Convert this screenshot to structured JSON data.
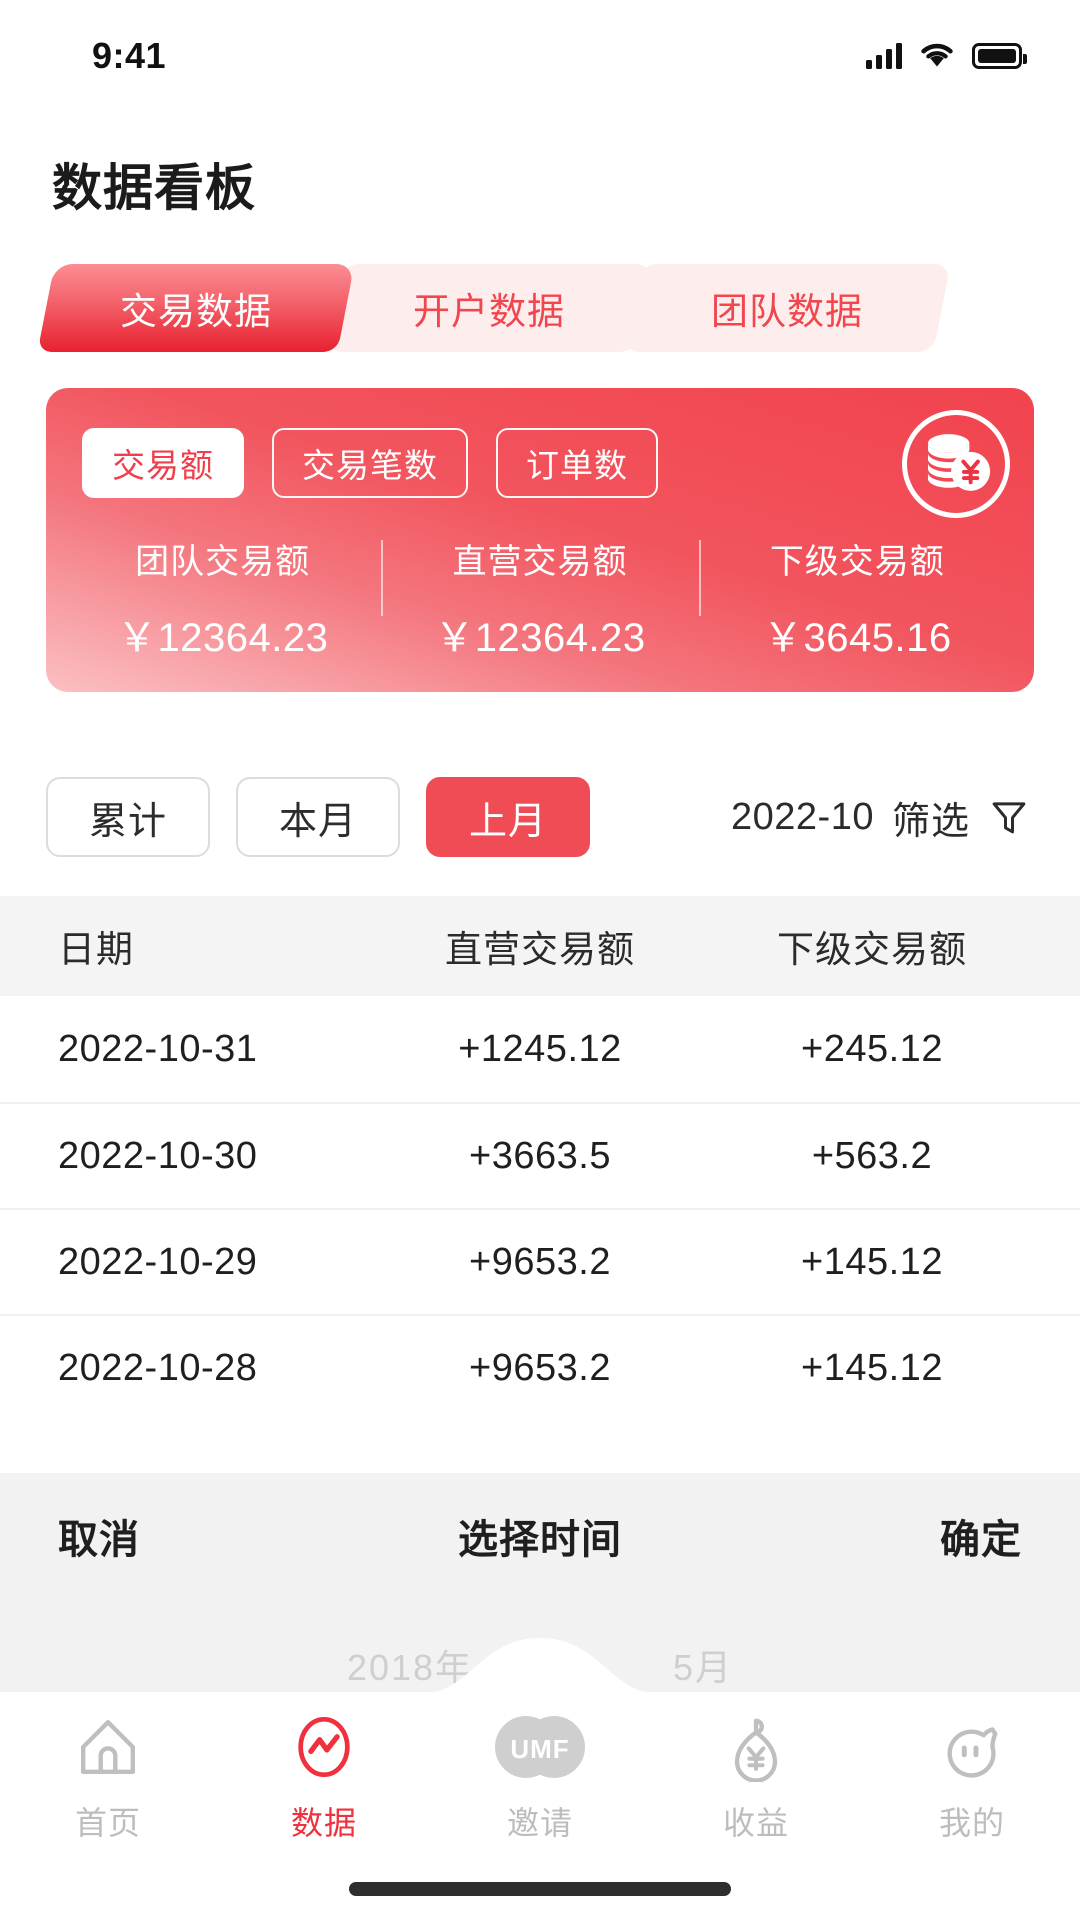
{
  "status_bar": {
    "time": "9:41",
    "signal_icon": "cellular-signal-icon",
    "wifi_icon": "wifi-icon",
    "battery_icon": "battery-icon"
  },
  "page": {
    "title": "数据看板"
  },
  "tabs": [
    {
      "label": "交易数据",
      "active": true
    },
    {
      "label": "开户数据",
      "active": false
    },
    {
      "label": "团队数据",
      "active": false
    }
  ],
  "summary_card": {
    "badge_icon": "coin-stack-yuan-icon",
    "segments": [
      {
        "label": "交易额",
        "active": true
      },
      {
        "label": "交易笔数",
        "active": false
      },
      {
        "label": "订单数",
        "active": false
      }
    ],
    "stats": [
      {
        "label": "团队交易额",
        "value": "￥12364.23"
      },
      {
        "label": "直营交易额",
        "value": "￥12364.23"
      },
      {
        "label": "下级交易额",
        "value": "￥3645.16"
      }
    ],
    "colors": {
      "gradient_start": "#f1434e",
      "gradient_end": "#fbc0c3"
    }
  },
  "filter": {
    "chips": [
      {
        "label": "累计",
        "active": false
      },
      {
        "label": "本月",
        "active": false
      },
      {
        "label": "上月",
        "active": true
      }
    ],
    "month": "2022-10",
    "filter_label": "筛选",
    "filter_icon": "funnel-icon",
    "active_color": "#ef4c55"
  },
  "table": {
    "headers": [
      "日期",
      "直营交易额",
      "下级交易额"
    ],
    "rows": [
      {
        "date": "2022-10-31",
        "direct": "+1245.12",
        "sub": "+245.12"
      },
      {
        "date": "2022-10-30",
        "direct": "+3663.5",
        "sub": "+563.2"
      },
      {
        "date": "2022-10-29",
        "direct": "+9653.2",
        "sub": "+145.12"
      },
      {
        "date": "2022-10-28",
        "direct": "+9653.2",
        "sub": "+145.12"
      }
    ]
  },
  "date_picker": {
    "cancel": "取消",
    "title": "选择时间",
    "confirm": "确定",
    "year": "2018年",
    "month": "5月"
  },
  "tab_bar": {
    "items": [
      {
        "label": "首页",
        "icon": "home-icon",
        "active": false
      },
      {
        "label": "数据",
        "icon": "chart-circle-icon",
        "active": true
      },
      {
        "label": "邀请",
        "icon": "umf-logo-icon",
        "active": false
      },
      {
        "label": "收益",
        "icon": "money-bag-yuan-icon",
        "active": false
      },
      {
        "label": "我的",
        "icon": "piggy-face-icon",
        "active": false
      }
    ],
    "active_color": "#f0303c",
    "inactive_color": "#bdbdbd"
  }
}
